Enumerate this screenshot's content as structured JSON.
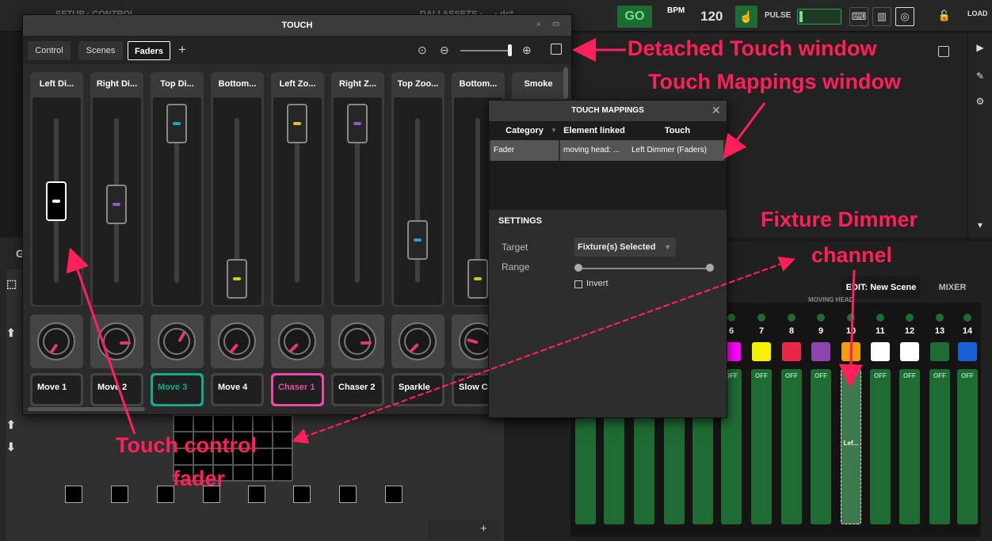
{
  "topbar": {
    "ghost_left": "SETUP · CONTROL",
    "ghost_mid": "DALI ASSETS · ... · dc*",
    "go_label": "GO",
    "bpm_label": "BPM",
    "bpm_value": "120",
    "pulse_label": "PULSE",
    "load_label": "LOAD",
    "icons": [
      "keyboard-icon",
      "piano-icon",
      "target-icon",
      "lock-icon"
    ]
  },
  "touch_window": {
    "title": "TOUCH",
    "tabs": [
      {
        "label": "Control"
      },
      {
        "label": "Scenes"
      },
      {
        "label": "Faders",
        "active": true
      }
    ],
    "add_tab_label": "+",
    "faders": [
      {
        "name": "Left Di...",
        "level": 0.5,
        "color": "#ffffff",
        "selected": true
      },
      {
        "name": "Right Di...",
        "level": 0.48,
        "color": "#8e5bbf"
      },
      {
        "name": "Top Di...",
        "level": 1.0,
        "color": "#1fa5c0"
      },
      {
        "name": "Bottom...",
        "level": 0.0,
        "color": "#c6d21a"
      },
      {
        "name": "Left Zo...",
        "level": 1.0,
        "color": "#e6c21a"
      },
      {
        "name": "Right Z...",
        "level": 1.0,
        "color": "#8e5bbf"
      },
      {
        "name": "Top Zoo...",
        "level": 0.25,
        "color": "#1fa5c0"
      },
      {
        "name": "Bottom...",
        "level": 0.0,
        "color": "#c6d21a"
      },
      {
        "name": "Smoke",
        "level": null,
        "color": "#888888"
      }
    ],
    "knobs": [
      {
        "angle": 215
      },
      {
        "angle": 90
      },
      {
        "angle": 30
      },
      {
        "angle": 220
      },
      {
        "angle": 225
      },
      {
        "angle": 90
      },
      {
        "angle": 225
      },
      {
        "angle": 285
      }
    ],
    "buttons": [
      {
        "label": "Move 1",
        "border": "#444444",
        "text_color": "#ffffff"
      },
      {
        "label": "Move 2",
        "border": "#444444",
        "text_color": "#ffffff"
      },
      {
        "label": "Move 3",
        "border": "#1aa88a",
        "text_color": "#1aa88a"
      },
      {
        "label": "Move 4",
        "border": "#444444",
        "text_color": "#ffffff"
      },
      {
        "label": "Chaser 1",
        "border": "#e84aa8",
        "text_color": "#e84aa8"
      },
      {
        "label": "Chaser 2",
        "border": "#444444",
        "text_color": "#ffffff"
      },
      {
        "label": "Sparkle",
        "border": "#444444",
        "text_color": "#ffffff"
      },
      {
        "label": "Slow C",
        "border": "#444444",
        "text_color": "#ffffff"
      }
    ]
  },
  "touch_mappings": {
    "title": "TOUCH MAPPINGS",
    "columns": [
      "Category",
      "Element linked",
      "Touch"
    ],
    "row": {
      "category": "Fader",
      "element": "moving head: ...",
      "touch": "Left Dimmer (Faders)"
    },
    "settings_label": "SETTINGS",
    "target_label": "Target",
    "target_value": "Fixture(s) Selected",
    "range_label": "Range",
    "range": [
      0,
      1
    ],
    "invert_label": "Invert",
    "invert_checked": false
  },
  "scene_editor": {
    "edit_tab": "EDIT: New Scene",
    "mixer_tab": "MIXER",
    "group_label": "MOVING HEAD",
    "channels": [
      {
        "num": "6",
        "color": "#ff00ff",
        "state": "OFF"
      },
      {
        "num": "7",
        "color": "#f7f200",
        "state": "OFF"
      },
      {
        "num": "8",
        "color": "#e8274a",
        "state": "OFF"
      },
      {
        "num": "9",
        "color": "#8e44ad",
        "state": "OFF"
      },
      {
        "num": "10",
        "color": "#f39c12",
        "state": "Lef...",
        "selected": true
      },
      {
        "num": "11",
        "color": "#ffffff",
        "state": "OFF"
      },
      {
        "num": "12",
        "color": "#ffffff",
        "state": "OFF"
      },
      {
        "num": "13",
        "color": "#1f6b34",
        "state": "OFF"
      },
      {
        "num": "14",
        "color": "#1a5fd6",
        "state": "OFF"
      }
    ]
  },
  "annotations": {
    "detached": "Detached Touch window",
    "mappings": "Touch Mappings window",
    "fixture_line1": "Fixture Dimmer",
    "fixture_line2": "channel",
    "touch_line1": "Touch control",
    "touch_line2": "fader"
  },
  "colors": {
    "accent_pink": "#ff1f5a",
    "go_green": "#1f6b34"
  }
}
